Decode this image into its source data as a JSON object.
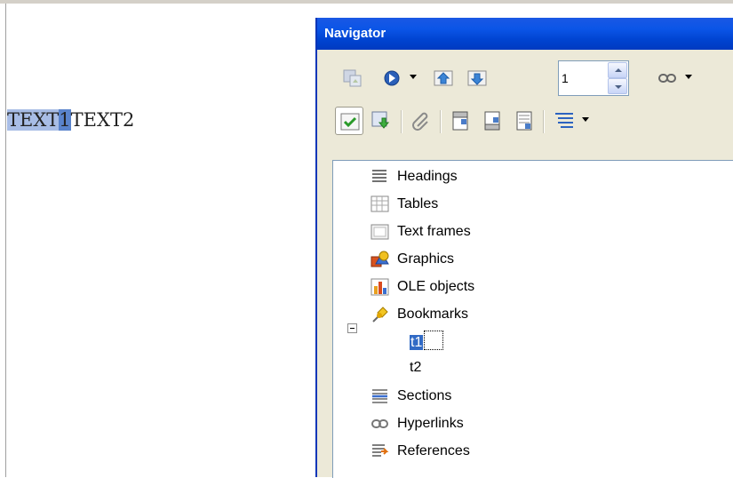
{
  "document": {
    "text_selected": "TEXT",
    "text_selected_strong": "1",
    "text_rest": "TEXT2"
  },
  "navigator": {
    "title": "Navigator",
    "toolbar1": {
      "icons": [
        "toggle-icon",
        "navigation-icon",
        "previous-icon",
        "next-icon",
        "link-icon"
      ],
      "page_number": "1"
    },
    "toolbar2": {
      "icons": [
        "list-box-icon",
        "content-view-icon",
        "reminder-icon",
        "header-icon",
        "footer-icon",
        "anchor-icon",
        "heading-levels-icon"
      ]
    },
    "tree": {
      "categories": [
        {
          "label": "Headings",
          "icon": "headings-icon"
        },
        {
          "label": "Tables",
          "icon": "tables-icon"
        },
        {
          "label": "Text frames",
          "icon": "text-frames-icon"
        },
        {
          "label": "Graphics",
          "icon": "graphics-icon"
        },
        {
          "label": "OLE objects",
          "icon": "ole-objects-icon"
        },
        {
          "label": "Bookmarks",
          "icon": "bookmarks-icon",
          "expanded": true,
          "children": [
            {
              "label": "t1",
              "selected": true
            },
            {
              "label": "t2",
              "selected": false
            }
          ]
        },
        {
          "label": "Sections",
          "icon": "sections-icon"
        },
        {
          "label": "Hyperlinks",
          "icon": "hyperlinks-icon"
        },
        {
          "label": "References",
          "icon": "references-icon"
        }
      ]
    }
  },
  "colors": {
    "title_bar": "#0b55e7",
    "selection": "#316ac5",
    "doc_highlight": "#a8bde6"
  }
}
